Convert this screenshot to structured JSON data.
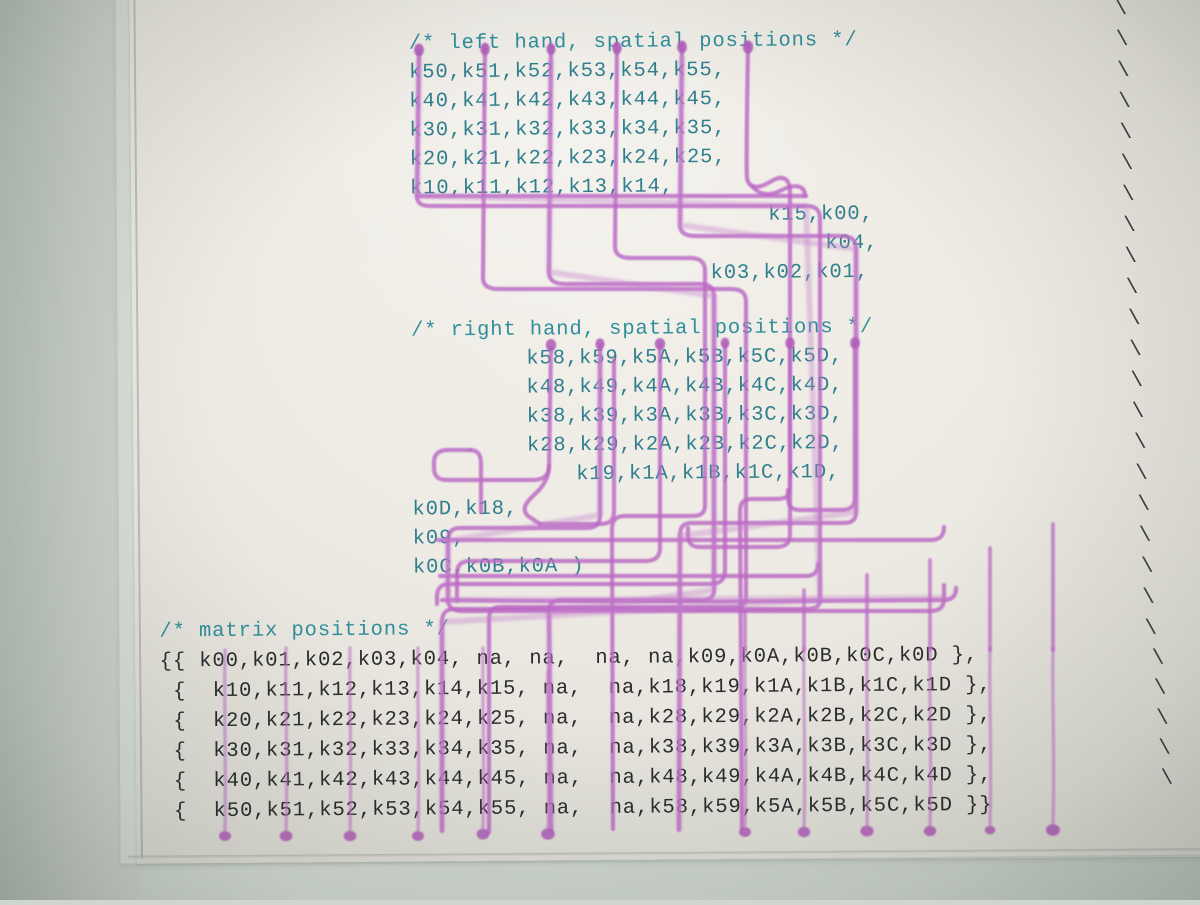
{
  "document": {
    "kind": "printed-source-code-photograph",
    "subject": "keyboard key matrix layout macro",
    "colors": {
      "comment_teal": "#2f8e9b",
      "identifier_teal": "#2f7f8e",
      "matrix_black": "#2a2c2e",
      "marker_purple": "#b濃",
      "marker_purple_hex": "#b865c0",
      "paper": "#efece5",
      "desk": "#cdd4ce"
    }
  },
  "code": {
    "left_hand": {
      "comment": "/* left hand, spatial positions */",
      "rows": [
        "k50,k51,k52,k53,k54,k55,",
        "k40,k41,k42,k43,k44,k45,",
        "k30,k31,k32,k33,k34,k35,",
        "k20,k21,k22,k23,k24,k25,",
        "k10,k11,k12,k13,k14,"
      ],
      "thumb_rows": [
        "k15,k00,",
        "k04,",
        "k03,k02,k01,"
      ]
    },
    "right_hand": {
      "comment": "/* right hand, spatial positions */",
      "rows": [
        "k58,k59,k5A,k5B,k5C,k5D,",
        "k48,k49,k4A,k4B,k4C,k4D,",
        "k38,k39,k3A,k3B,k3C,k3D,",
        "k28,k29,k2A,k2B,k2C,k2D,",
        "k19,k1A,k1B,k1C,k1D,"
      ],
      "thumb_rows": [
        "k0D,k18,",
        "k09,",
        "k0C,k0B,k0A )"
      ]
    },
    "matrix": {
      "comment": "/* matrix positions */",
      "rows": [
        "{{ k00,k01,k02,k03,k04, na, na,  na, na,k09,k0A,k0B,k0C,k0D },",
        " {  k10,k11,k12,k13,k14,k15, na,  na,k18,k19,k1A,k1B,k1C,k1D },",
        " {  k20,k21,k22,k23,k24,k25, na,  na,k28,k29,k2A,k2B,k2C,k2D },",
        " {  k30,k31,k32,k33,k34,k35, na,  na,k38,k39,k3A,k3B,k3C,k3D },",
        " {  k40,k41,k42,k43,k44,k45, na,  na,k48,k49,k4A,k4B,k4C,k4D },",
        " {  k50,k51,k52,k53,k54,k55, na,  na,k58,k59,k5A,k5B,k5C,k5D }}"
      ],
      "continuations": [
        "\\",
        "\\",
        "\\",
        "\\",
        "\\",
        "\\"
      ]
    },
    "line_continuations_upper": [
      "\\",
      "\\",
      "\\",
      "\\",
      "\\",
      "\\",
      "\\",
      "\\",
      "\\",
      "\\",
      "\\",
      "\\",
      "\\",
      "\\",
      "\\",
      "\\",
      "\\",
      "\\",
      "\\",
      "\\",
      "\\",
      "\\",
      "\\",
      "\\",
      "\\",
      "\\"
    ]
  },
  "annotations": {
    "tool": "purple highlighter / marker pen",
    "description": "Hand-drawn lines joining each key identifier in the spatial-position block down to the same identifier in the matrix-positions block",
    "dot_count_left": 6,
    "dot_count_right": 6,
    "dot_count_matrix_bottom": 12
  }
}
